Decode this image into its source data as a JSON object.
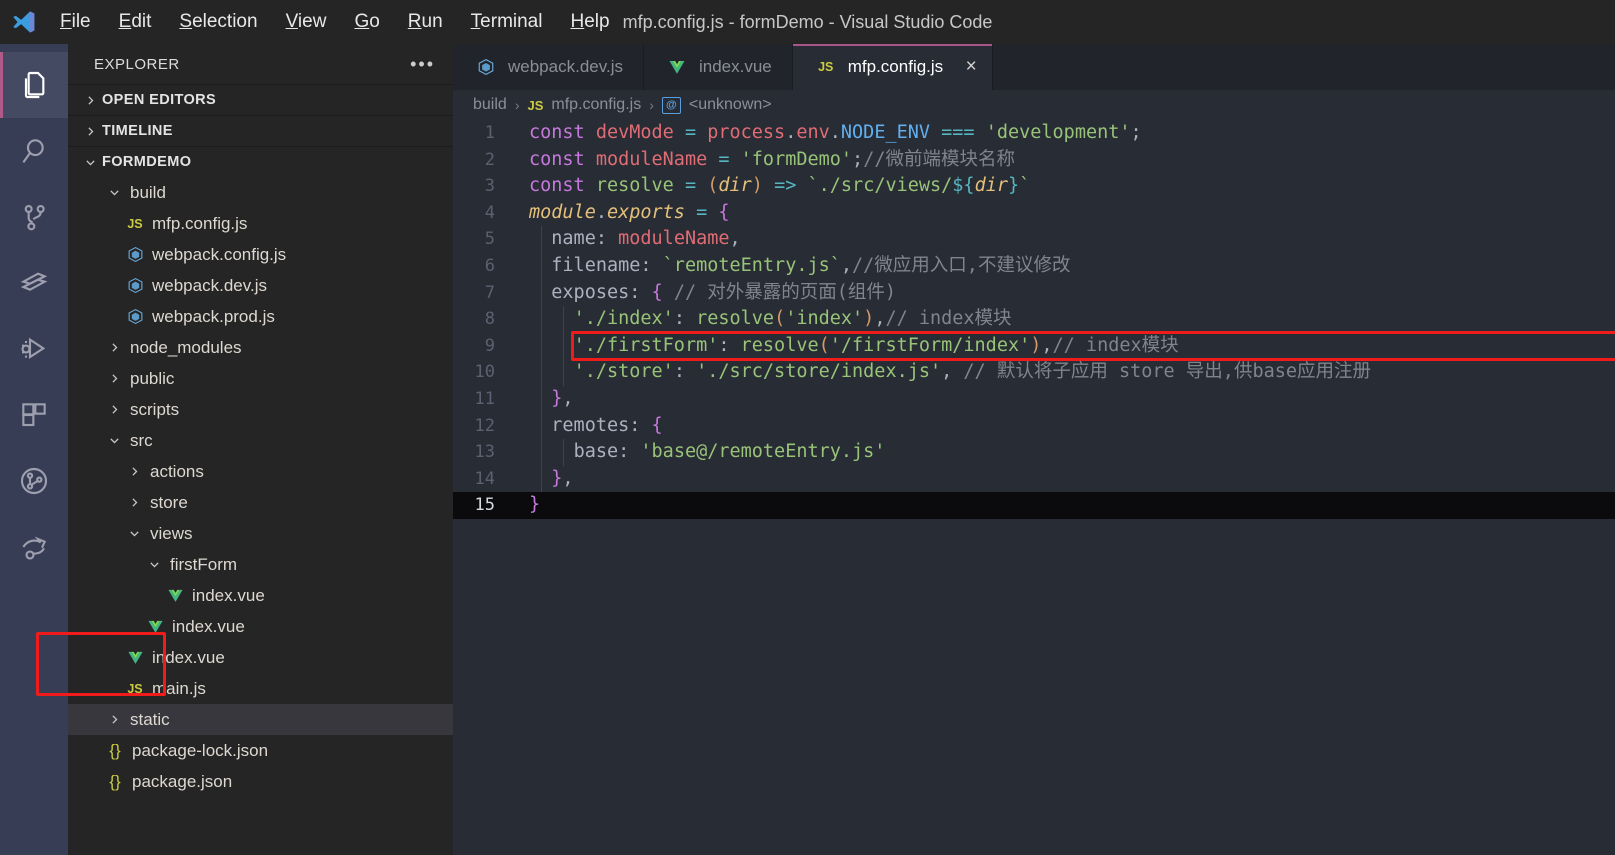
{
  "window": {
    "title": "mfp.config.js - formDemo - Visual Studio Code",
    "logo_icon": "vscode-logo-icon"
  },
  "menu": [
    {
      "label": "File",
      "mnemonic": "F"
    },
    {
      "label": "Edit",
      "mnemonic": "E"
    },
    {
      "label": "Selection",
      "mnemonic": "S"
    },
    {
      "label": "View",
      "mnemonic": "V"
    },
    {
      "label": "Go",
      "mnemonic": "G"
    },
    {
      "label": "Run",
      "mnemonic": "R"
    },
    {
      "label": "Terminal",
      "mnemonic": "T"
    },
    {
      "label": "Help",
      "mnemonic": "H"
    }
  ],
  "activity_bar": {
    "items": [
      {
        "icon": "explorer-files-icon",
        "active": true
      },
      {
        "icon": "search-icon",
        "active": false
      },
      {
        "icon": "source-control-icon",
        "active": false
      },
      {
        "icon": "live-share-icon",
        "active": false
      },
      {
        "icon": "run-and-debug-icon",
        "active": false
      },
      {
        "icon": "extensions-icon",
        "active": false
      },
      {
        "icon": "git-graph-icon",
        "active": false
      },
      {
        "icon": "remote-explorer-icon",
        "active": false
      }
    ],
    "accent_color": "#b05a8a"
  },
  "sidebar": {
    "title": "EXPLORER",
    "more_actions_icon": "ellipsis-icon",
    "sections": [
      {
        "label": "OPEN EDITORS",
        "expanded": false
      },
      {
        "label": "TIMELINE",
        "expanded": false
      },
      {
        "label": "FORMDEMO",
        "expanded": true
      }
    ],
    "tree": [
      {
        "label": "build",
        "type": "folder",
        "expanded": true,
        "indent": 1,
        "icon": "chevron-down-icon"
      },
      {
        "label": "mfp.config.js",
        "type": "file",
        "indent": 2,
        "icon": "js-file-icon"
      },
      {
        "label": "webpack.config.js",
        "type": "file",
        "indent": 2,
        "icon": "webpack-file-icon"
      },
      {
        "label": "webpack.dev.js",
        "type": "file",
        "indent": 2,
        "icon": "webpack-file-icon"
      },
      {
        "label": "webpack.prod.js",
        "type": "file",
        "indent": 2,
        "icon": "webpack-file-icon"
      },
      {
        "label": "node_modules",
        "type": "folder",
        "expanded": false,
        "indent": 1,
        "icon": "chevron-right-icon"
      },
      {
        "label": "public",
        "type": "folder",
        "expanded": false,
        "indent": 1,
        "icon": "chevron-right-icon"
      },
      {
        "label": "scripts",
        "type": "folder",
        "expanded": false,
        "indent": 1,
        "icon": "chevron-right-icon"
      },
      {
        "label": "src",
        "type": "folder",
        "expanded": true,
        "indent": 1,
        "icon": "chevron-down-icon"
      },
      {
        "label": "actions",
        "type": "folder",
        "expanded": false,
        "indent": 2,
        "icon": "chevron-right-icon"
      },
      {
        "label": "store",
        "type": "folder",
        "expanded": false,
        "indent": 2,
        "icon": "chevron-right-icon"
      },
      {
        "label": "views",
        "type": "folder",
        "expanded": true,
        "indent": 2,
        "icon": "chevron-down-icon"
      },
      {
        "label": "firstForm",
        "type": "folder",
        "expanded": true,
        "indent": 3,
        "icon": "chevron-down-icon",
        "highlighted": true
      },
      {
        "label": "index.vue",
        "type": "file",
        "indent": 4,
        "icon": "vue-file-icon",
        "highlighted": true
      },
      {
        "label": "index.vue",
        "type": "file",
        "indent": 3,
        "icon": "vue-file-icon"
      },
      {
        "label": "index.vue",
        "type": "file",
        "indent": 2,
        "icon": "vue-file-icon"
      },
      {
        "label": "main.js",
        "type": "file",
        "indent": 2,
        "icon": "js-file-icon"
      },
      {
        "label": "static",
        "type": "folder",
        "expanded": false,
        "indent": 1,
        "icon": "chevron-right-icon",
        "selected": true
      },
      {
        "label": "package-lock.json",
        "type": "file",
        "indent": 1,
        "icon": "json-file-icon"
      },
      {
        "label": "package.json",
        "type": "file",
        "indent": 1,
        "icon": "json-file-icon"
      }
    ],
    "highlight_color": "#f01c1c"
  },
  "tabs": [
    {
      "label": "webpack.dev.js",
      "icon": "webpack-file-icon",
      "active": false
    },
    {
      "label": "index.vue",
      "icon": "vue-file-icon",
      "active": false
    },
    {
      "label": "mfp.config.js",
      "icon": "js-file-icon",
      "active": true,
      "close_icon": "close-icon"
    }
  ],
  "breadcrumb": {
    "items": [
      {
        "label": "build",
        "icon": ""
      },
      {
        "label": "mfp.config.js",
        "icon": "js-file-icon"
      },
      {
        "label": "<unknown>",
        "icon": "symbol-icon"
      }
    ],
    "separator": "›"
  },
  "editor": {
    "language": "javascript",
    "current_line": 15,
    "highlighted_line": 9,
    "lines": [
      {
        "n": 1,
        "text": "const devMode = process.env.NODE_ENV === 'development';"
      },
      {
        "n": 2,
        "text": "const moduleName = 'formDemo';//微前端模块名称"
      },
      {
        "n": 3,
        "text": "const resolve = (dir) => `./src/views/${dir}`"
      },
      {
        "n": 4,
        "text": "module.exports = {"
      },
      {
        "n": 5,
        "text": "  name: moduleName,"
      },
      {
        "n": 6,
        "text": "  filename: `remoteEntry.js`,//微应用入口,不建议修改"
      },
      {
        "n": 7,
        "text": "  exposes: { // 对外暴露的页面(组件)"
      },
      {
        "n": 8,
        "text": "    './index': resolve('index'),// index模块"
      },
      {
        "n": 9,
        "text": "    './firstForm': resolve('/firstForm/index'),// index模块"
      },
      {
        "n": 10,
        "text": "    './store': './src/store/index.js', // 默认将子应用 store 导出,供base应用注册"
      },
      {
        "n": 11,
        "text": "  },"
      },
      {
        "n": 12,
        "text": "  remotes: {"
      },
      {
        "n": 13,
        "text": "    base: 'base@/remoteEntry.js'"
      },
      {
        "n": 14,
        "text": "  },"
      },
      {
        "n": 15,
        "text": "}"
      }
    ]
  }
}
